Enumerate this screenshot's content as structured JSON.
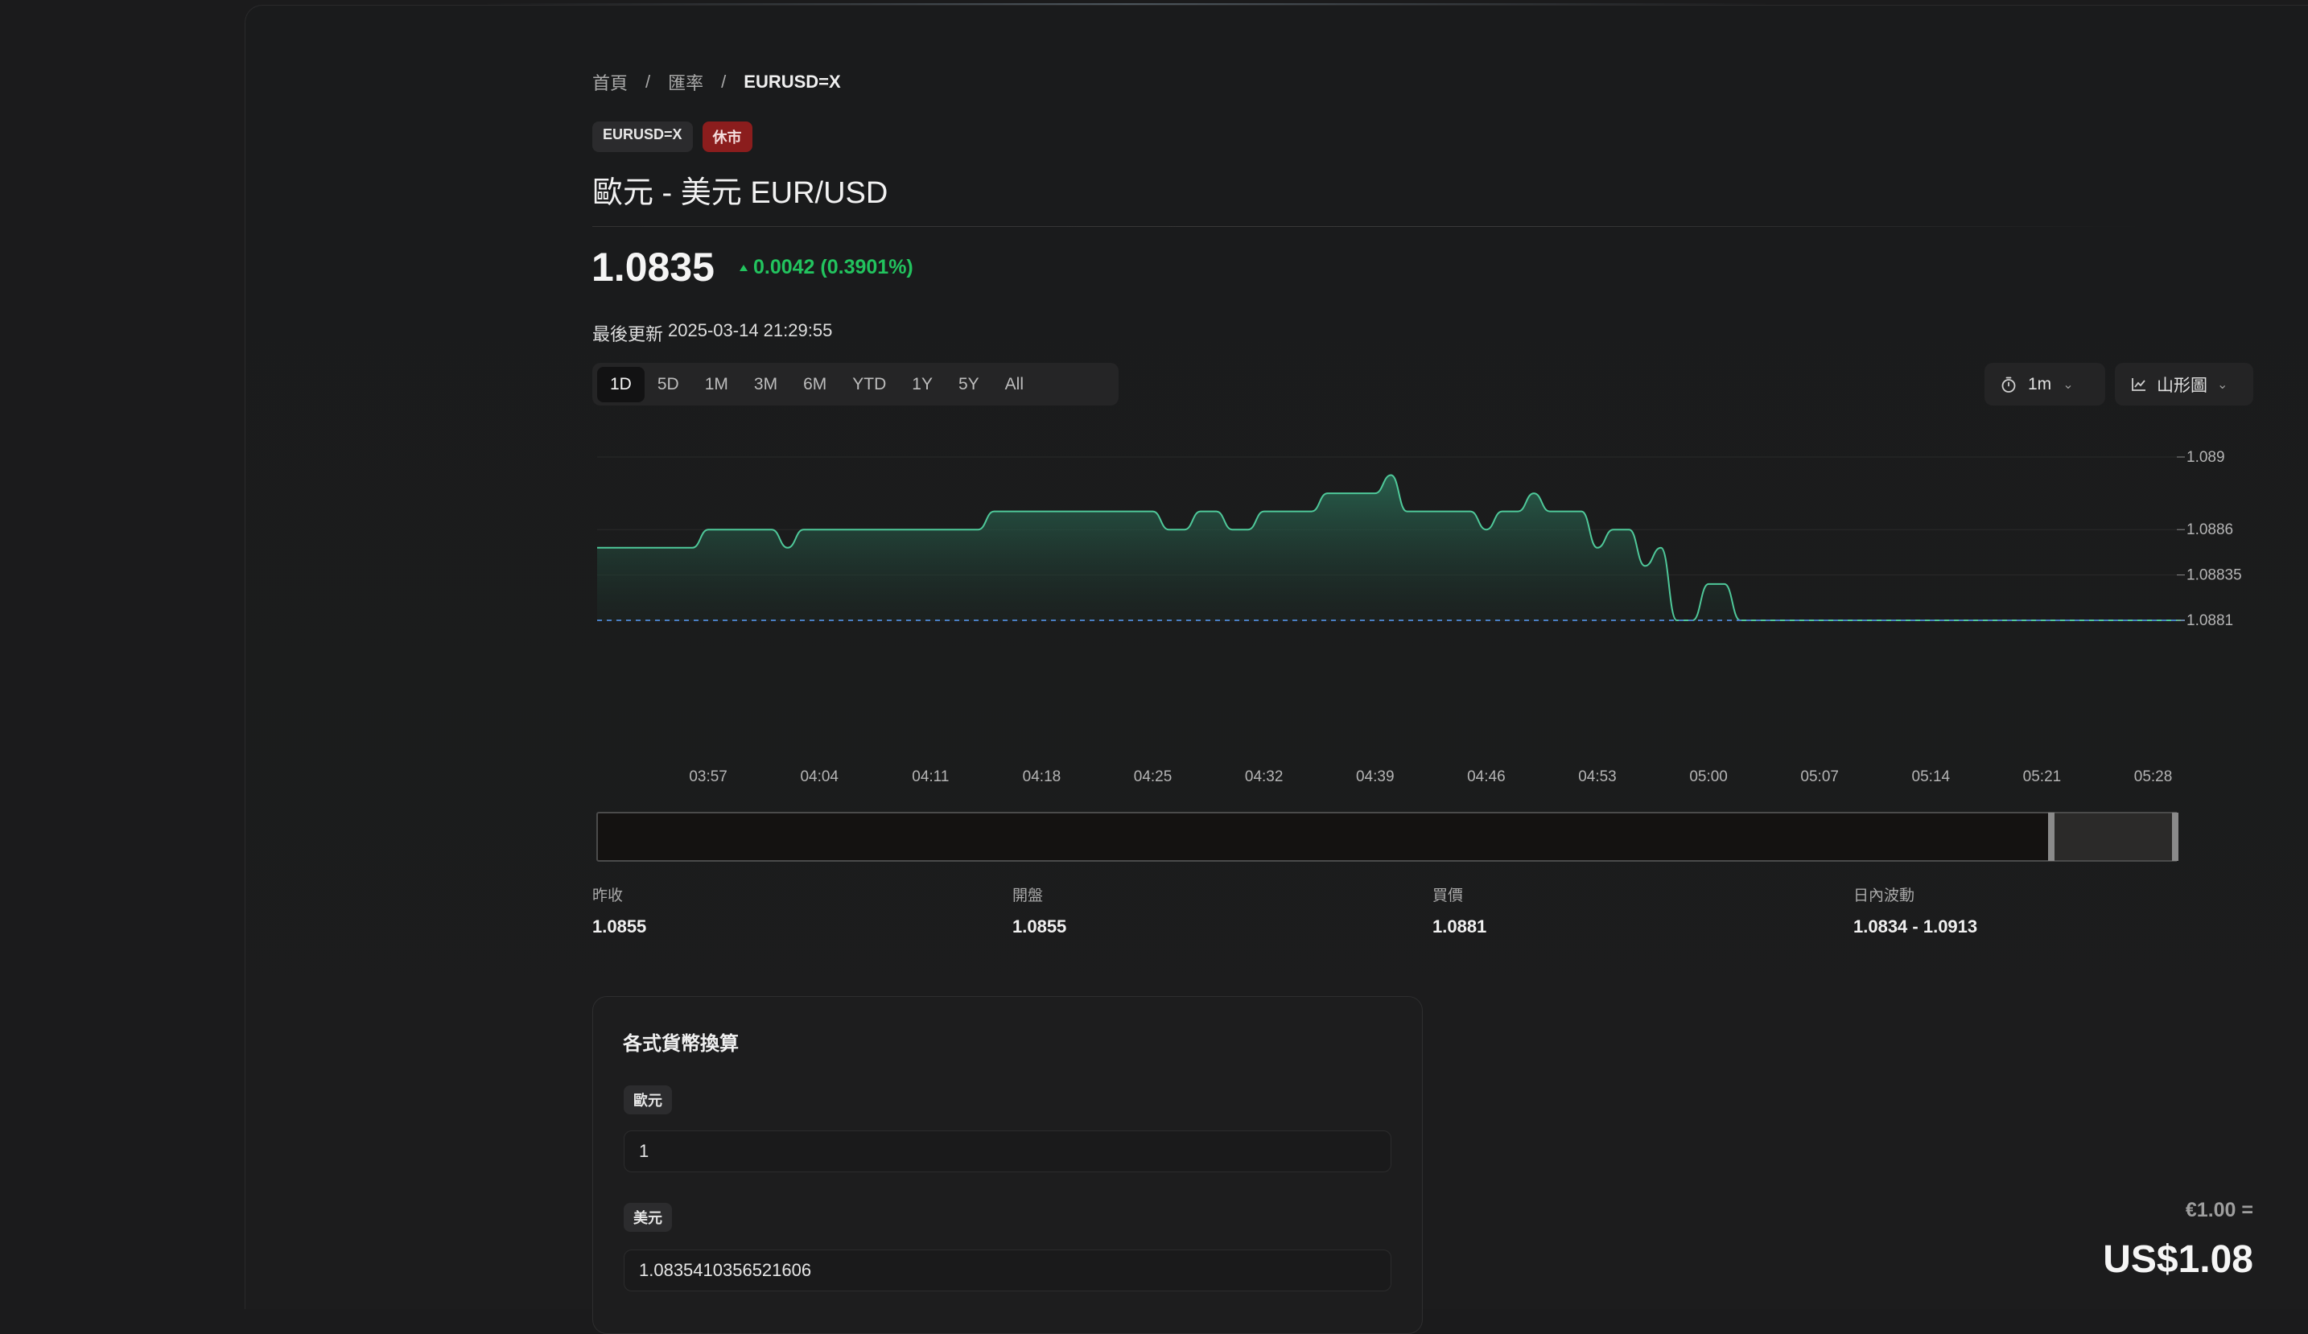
{
  "breadcrumb": {
    "home": "首頁",
    "section": "匯率",
    "current": "EURUSD=X",
    "sep": "/"
  },
  "badges": {
    "symbol": "EURUSD=X",
    "status": "休市"
  },
  "title": "歐元 - 美元 EUR/USD",
  "quote": {
    "price": "1.0835",
    "change": "0.0042 (0.3901%)"
  },
  "updated": {
    "label": "最後更新",
    "value": "2025-03-14 21:29:55"
  },
  "ranges": [
    "1D",
    "5D",
    "1M",
    "3M",
    "6M",
    "YTD",
    "1Y",
    "5Y",
    "All"
  ],
  "active_range": "1D",
  "interval": {
    "value": "1m"
  },
  "chart_type": {
    "value": "山形圖"
  },
  "colors": {
    "up": "#22c35e",
    "area_line": "#4fc99a",
    "closed_badge": "#8b1d1d"
  },
  "chart_data": {
    "type": "area",
    "x": [
      "03:50",
      "03:51",
      "03:52",
      "03:53",
      "03:54",
      "03:55",
      "03:56",
      "03:57",
      "03:58",
      "03:59",
      "04:00",
      "04:01",
      "04:02",
      "04:03",
      "04:04",
      "04:05",
      "04:06",
      "04:07",
      "04:08",
      "04:09",
      "04:10",
      "04:11",
      "04:12",
      "04:13",
      "04:14",
      "04:15",
      "04:16",
      "04:17",
      "04:18",
      "04:19",
      "04:20",
      "04:21",
      "04:22",
      "04:23",
      "04:24",
      "04:25",
      "04:26",
      "04:27",
      "04:28",
      "04:29",
      "04:30",
      "04:31",
      "04:32",
      "04:33",
      "04:34",
      "04:35",
      "04:36",
      "04:37",
      "04:38",
      "04:39",
      "04:40",
      "04:41",
      "04:42",
      "04:43",
      "04:44",
      "04:45",
      "04:46",
      "04:47",
      "04:48",
      "04:49",
      "04:50",
      "04:51",
      "04:52",
      "04:53",
      "04:54",
      "04:55",
      "04:56",
      "04:57",
      "04:58",
      "04:59",
      "05:00",
      "05:01",
      "05:02",
      "05:03",
      "05:04",
      "05:05",
      "05:06",
      "05:07",
      "05:08",
      "05:09",
      "05:10",
      "05:11",
      "05:12",
      "05:13",
      "05:14",
      "05:15",
      "05:16",
      "05:17",
      "05:18",
      "05:19",
      "05:20",
      "05:21",
      "05:22",
      "05:23",
      "05:24",
      "05:25",
      "05:26",
      "05:27",
      "05:28",
      "05:29",
      "05:30"
    ],
    "y": [
      1.0885,
      1.0885,
      1.0885,
      1.0885,
      1.0885,
      1.0885,
      1.0885,
      1.0886,
      1.0886,
      1.0886,
      1.0886,
      1.0886,
      1.0885,
      1.0886,
      1.0886,
      1.0886,
      1.0886,
      1.0886,
      1.0886,
      1.0886,
      1.0886,
      1.0886,
      1.0886,
      1.0886,
      1.0886,
      1.0887,
      1.0887,
      1.0887,
      1.0887,
      1.0887,
      1.0887,
      1.0887,
      1.0887,
      1.0887,
      1.0887,
      1.0887,
      1.0886,
      1.0886,
      1.0887,
      1.0887,
      1.0886,
      1.0886,
      1.0887,
      1.0887,
      1.0887,
      1.0887,
      1.0888,
      1.0888,
      1.0888,
      1.0888,
      1.0889,
      1.0887,
      1.0887,
      1.0887,
      1.0887,
      1.0887,
      1.0886,
      1.0887,
      1.0887,
      1.0888,
      1.0887,
      1.0887,
      1.0887,
      1.0885,
      1.0886,
      1.0886,
      1.0884,
      1.0885,
      1.0881,
      1.0881,
      1.0883,
      1.0883,
      1.0881,
      1.0881,
      1.0881,
      1.0881,
      1.0881,
      1.0881,
      1.0881,
      1.0881,
      1.0881,
      1.0881,
      1.0881,
      1.0881,
      1.0881,
      1.0881,
      1.0881,
      1.0881,
      1.0881,
      1.0881,
      1.0881,
      1.0881,
      1.0881,
      1.0881,
      1.0881,
      1.0881,
      1.0881,
      1.0881,
      1.0881,
      1.0881,
      1.0881
    ],
    "ylim": [
      1.0881,
      1.089
    ],
    "y_ticks": [
      "1.089",
      "1.0886",
      "1.08835",
      "1.0881"
    ],
    "x_ticks": [
      "03:57",
      "04:04",
      "04:11",
      "04:18",
      "04:25",
      "04:32",
      "04:39",
      "04:46",
      "04:53",
      "05:00",
      "05:07",
      "05:14",
      "05:21",
      "05:28"
    ],
    "reference_line": 1.0881,
    "grid": true
  },
  "stats": [
    {
      "label": "昨收",
      "value": "1.0855"
    },
    {
      "label": "開盤",
      "value": "1.0855"
    },
    {
      "label": "買價",
      "value": "1.0881"
    },
    {
      "label": "日內波動",
      "value": "1.0834 - 1.0913"
    }
  ],
  "converter": {
    "title": "各式貨幣換算",
    "from_currency": "歐元",
    "from_value": "1",
    "to_currency": "美元",
    "to_value": "1.0835410356521606"
  },
  "rate_summary": {
    "from": "€1.00 =",
    "to": "US$1.08"
  }
}
